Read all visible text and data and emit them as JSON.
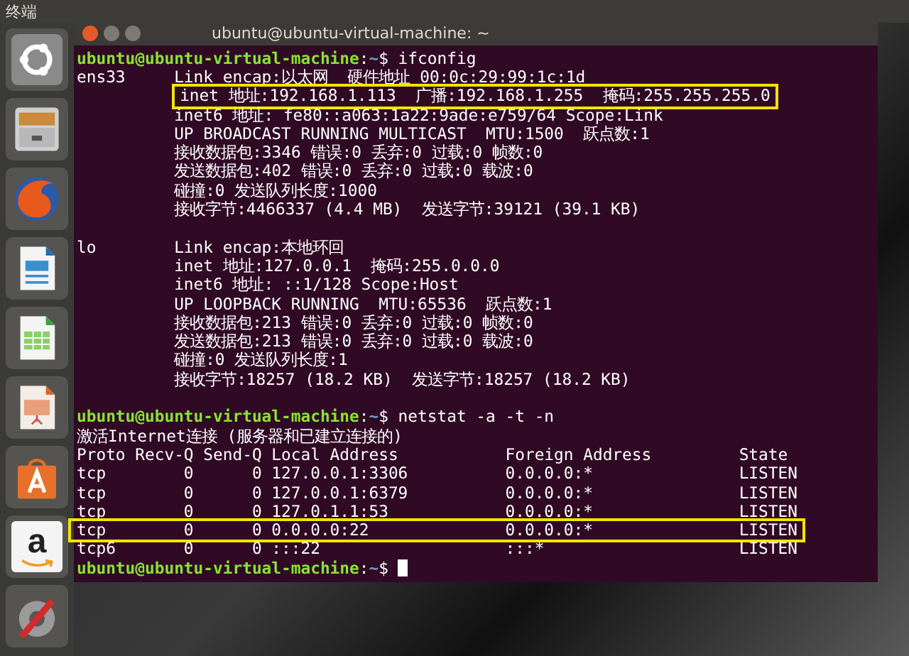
{
  "top_bar": {
    "title": "终端"
  },
  "launcher": [
    {
      "kind": "ubuntu",
      "selected": false
    },
    {
      "kind": "files",
      "selected": false
    },
    {
      "kind": "browser",
      "selected": false
    },
    {
      "kind": "writer",
      "selected": false
    },
    {
      "kind": "calc",
      "selected": false
    },
    {
      "kind": "impress",
      "selected": false
    },
    {
      "kind": "store",
      "selected": false
    },
    {
      "kind": "amazon",
      "selected": false,
      "glyph": "a"
    },
    {
      "kind": "settings",
      "selected": false
    }
  ],
  "window": {
    "title": "ubuntu@ubuntu-virtual-machine: ~",
    "lines": [
      {
        "kind": "prompt",
        "user_host": "ubuntu@ubuntu-virtual-machine",
        "colon": ":",
        "path": "~",
        "rest": "$ ifconfig",
        "cursor": false
      },
      {
        "kind": "output",
        "text": "ens33     Link encap:以太网  硬件地址 00:0c:29:99:1c:1d",
        "highlighted": false
      },
      {
        "kind": "output",
        "indented": true,
        "text": "inet 地址:192.168.1.113  广播:192.168.1.255  掩码:255.255.255.0",
        "highlighted": true
      },
      {
        "kind": "output",
        "text": "          inet6 地址: fe80::a063:1a22:9ade:e759/64 Scope:Link",
        "highlighted": false
      },
      {
        "kind": "output",
        "text": "          UP BROADCAST RUNNING MULTICAST  MTU:1500  跃点数:1",
        "highlighted": false
      },
      {
        "kind": "output",
        "text": "          接收数据包:3346 错误:0 丢弃:0 过载:0 帧数:0",
        "highlighted": false
      },
      {
        "kind": "output",
        "text": "          发送数据包:402 错误:0 丢弃:0 过载:0 载波:0",
        "highlighted": false
      },
      {
        "kind": "output",
        "text": "          碰撞:0 发送队列长度:1000",
        "highlighted": false
      },
      {
        "kind": "output",
        "text": "          接收字节:4466337 (4.4 MB)  发送字节:39121 (39.1 KB)",
        "highlighted": false
      },
      {
        "kind": "blank"
      },
      {
        "kind": "output",
        "text": "lo        Link encap:本地环回",
        "highlighted": false
      },
      {
        "kind": "output",
        "text": "          inet 地址:127.0.0.1  掩码:255.0.0.0",
        "highlighted": false
      },
      {
        "kind": "output",
        "text": "          inet6 地址: ::1/128 Scope:Host",
        "highlighted": false
      },
      {
        "kind": "output",
        "text": "          UP LOOPBACK RUNNING  MTU:65536  跃点数:1",
        "highlighted": false
      },
      {
        "kind": "output",
        "text": "          接收数据包:213 错误:0 丢弃:0 过载:0 帧数:0",
        "highlighted": false
      },
      {
        "kind": "output",
        "text": "          发送数据包:213 错误:0 丢弃:0 过载:0 载波:0",
        "highlighted": false
      },
      {
        "kind": "output",
        "text": "          碰撞:0 发送队列长度:1",
        "highlighted": false
      },
      {
        "kind": "output",
        "text": "          接收字节:18257 (18.2 KB)  发送字节:18257 (18.2 KB)",
        "highlighted": false
      },
      {
        "kind": "blank"
      },
      {
        "kind": "prompt",
        "user_host": "ubuntu@ubuntu-virtual-machine",
        "colon": ":",
        "path": "~",
        "rest": "$ netstat -a -t -n",
        "cursor": false
      },
      {
        "kind": "output",
        "text": "激活Internet连接 (服务器和已建立连接的)",
        "highlighted": false
      },
      {
        "kind": "output",
        "text": "Proto Recv-Q Send-Q Local Address           Foreign Address         State",
        "highlighted": false
      },
      {
        "kind": "output",
        "text": "tcp        0      0 127.0.0.1:3306          0.0.0.0:*               LISTEN",
        "highlighted": false
      },
      {
        "kind": "output",
        "text": "tcp        0      0 127.0.0.1:6379          0.0.0.0:*               LISTEN",
        "highlighted": false
      },
      {
        "kind": "output",
        "text": "tcp        0      0 127.0.1.1:53            0.0.0.0:*               LISTEN",
        "highlighted": false
      },
      {
        "kind": "output",
        "text": "tcp        0      0 0.0.0.0:22              0.0.0.0:*               LISTEN",
        "highlighted": true
      },
      {
        "kind": "output",
        "text": "tcp6       0      0 :::22                   :::*                    LISTEN",
        "highlighted": false
      },
      {
        "kind": "prompt",
        "user_host": "ubuntu@ubuntu-virtual-machine",
        "colon": ":",
        "path": "~",
        "rest": "$ ",
        "cursor": true
      }
    ]
  }
}
